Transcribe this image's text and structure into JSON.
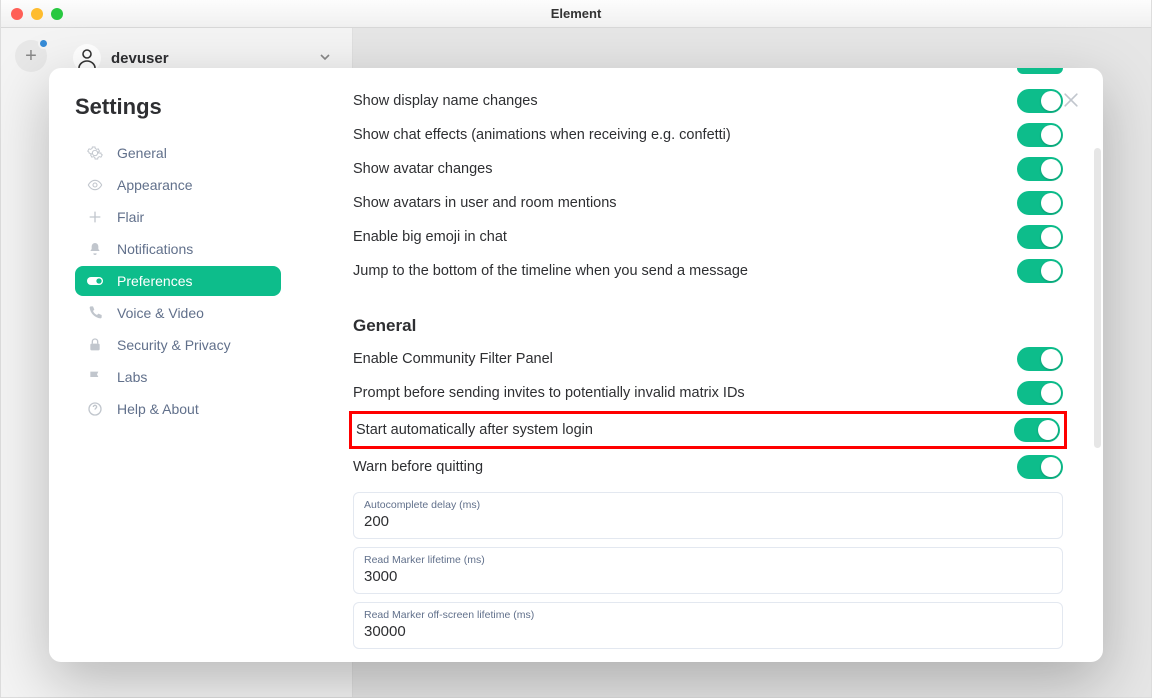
{
  "window": {
    "title": "Element"
  },
  "header": {
    "username": "devuser"
  },
  "modal": {
    "title": "Settings",
    "close_label": "Close",
    "sidebar": {
      "items": [
        {
          "label": "General",
          "icon": "gear-icon"
        },
        {
          "label": "Appearance",
          "icon": "eye-icon"
        },
        {
          "label": "Flair",
          "icon": "plus-icon"
        },
        {
          "label": "Notifications",
          "icon": "bell-icon"
        },
        {
          "label": "Preferences",
          "icon": "toggle-icon",
          "active": true
        },
        {
          "label": "Voice & Video",
          "icon": "phone-icon"
        },
        {
          "label": "Security & Privacy",
          "icon": "lock-icon"
        },
        {
          "label": "Labs",
          "icon": "flag-icon"
        },
        {
          "label": "Help & About",
          "icon": "help-icon"
        }
      ]
    }
  },
  "settings": {
    "top_rows": [
      {
        "label": "Show display name changes",
        "on": true
      },
      {
        "label": "Show chat effects (animations when receiving e.g. confetti)",
        "on": true
      },
      {
        "label": "Show avatar changes",
        "on": true
      },
      {
        "label": "Show avatars in user and room mentions",
        "on": true
      },
      {
        "label": "Enable big emoji in chat",
        "on": true
      },
      {
        "label": "Jump to the bottom of the timeline when you send a message",
        "on": true
      }
    ],
    "section2_head": "General",
    "section2_rows": [
      {
        "label": "Enable Community Filter Panel",
        "on": true
      },
      {
        "label": "Prompt before sending invites to potentially invalid matrix IDs",
        "on": true
      },
      {
        "label": "Start automatically after system login",
        "on": true,
        "highlight": true
      },
      {
        "label": "Warn before quitting",
        "on": true
      }
    ],
    "fields": [
      {
        "label": "Autocomplete delay (ms)",
        "value": "200"
      },
      {
        "label": "Read Marker lifetime (ms)",
        "value": "3000"
      },
      {
        "label": "Read Marker off-screen lifetime (ms)",
        "value": "30000"
      }
    ]
  }
}
